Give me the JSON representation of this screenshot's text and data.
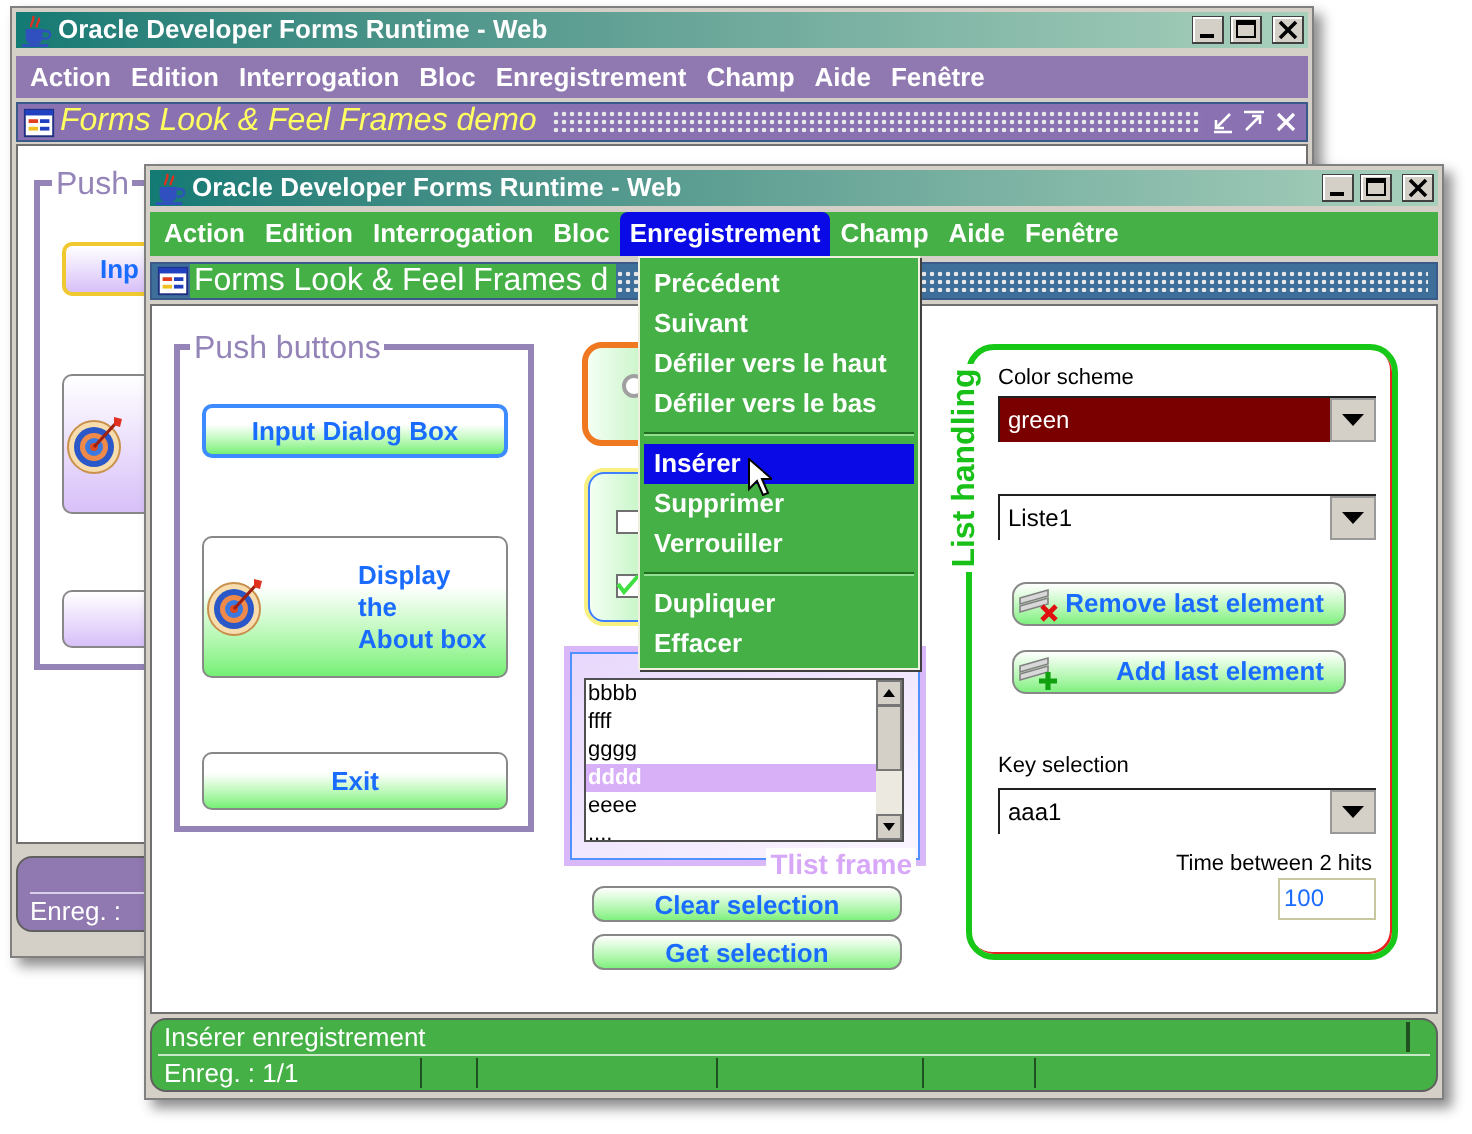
{
  "back_window": {
    "title": "Oracle Developer Forms Runtime - Web",
    "menu": [
      {
        "label": "Action"
      },
      {
        "label": "Edition"
      },
      {
        "label": "Interrogation"
      },
      {
        "label": "Bloc"
      },
      {
        "label": "Enregistrement"
      },
      {
        "label": "Champ"
      },
      {
        "label": "Aide"
      },
      {
        "label": "Fenêtre"
      }
    ],
    "form_title": "Forms Look & Feel Frames demo",
    "push_frame_label": "Push",
    "buttons": [
      {
        "kind": "text",
        "label": "Inp",
        "focused": true
      },
      {
        "kind": "icon",
        "focused": false
      },
      {
        "kind": "plain",
        "focused": false
      }
    ],
    "status_record": "Enreg. :"
  },
  "front_window": {
    "title": "Oracle Developer Forms Runtime - Web",
    "menu": [
      {
        "label": "Action",
        "selected": false
      },
      {
        "label": "Edition",
        "selected": false
      },
      {
        "label": "Interrogation",
        "selected": false
      },
      {
        "label": "Bloc",
        "selected": false
      },
      {
        "label": "Enregistrement",
        "selected": true
      },
      {
        "label": "Champ",
        "selected": false
      },
      {
        "label": "Aide",
        "selected": false
      },
      {
        "label": "Fenêtre",
        "selected": false
      }
    ],
    "form_title": "Forms Look & Feel Frames d",
    "dropdown_menu": [
      {
        "kind": "item",
        "label": "Précédent",
        "selected": false
      },
      {
        "kind": "item",
        "label": "Suivant",
        "selected": false
      },
      {
        "kind": "item",
        "label": "Défiler vers le haut",
        "selected": false
      },
      {
        "kind": "item",
        "label": "Défiler vers le bas",
        "selected": false
      },
      {
        "kind": "separator"
      },
      {
        "kind": "item",
        "label": "Insérer",
        "selected": true
      },
      {
        "kind": "item",
        "label": "Supprimer",
        "selected": false
      },
      {
        "kind": "item",
        "label": "Verrouiller",
        "selected": false
      },
      {
        "kind": "separator"
      },
      {
        "kind": "item",
        "label": "Dupliquer",
        "selected": false
      },
      {
        "kind": "item",
        "label": "Effacer",
        "selected": false
      }
    ],
    "push_buttons": {
      "label": "Push buttons",
      "buttons": [
        {
          "kind": "text",
          "label": "Input Dialog Box",
          "focused": true
        },
        {
          "kind": "icon",
          "lines": [
            "Display",
            "the",
            "About box"
          ],
          "focused": false
        },
        {
          "kind": "text",
          "label": "Exit",
          "focused": false
        }
      ]
    },
    "radio": {
      "selected": false
    },
    "checkboxes": [
      {
        "checked": false
      },
      {
        "checked": true
      }
    ],
    "tlist": {
      "label": "Tlist frame",
      "items": [
        {
          "label": "bbbb",
          "selected": false
        },
        {
          "label": "ffff",
          "selected": false
        },
        {
          "label": "gggg",
          "selected": false
        },
        {
          "label": "dddd",
          "selected": true
        },
        {
          "label": "eeee",
          "selected": false
        },
        {
          "label": "....",
          "selected": false
        }
      ]
    },
    "selection_buttons": [
      {
        "label": "Clear selection"
      },
      {
        "label": "Get selection"
      }
    ],
    "list_handling": {
      "label": "List handling",
      "color_scheme": {
        "label": "Color scheme",
        "value": "green",
        "focused": true
      },
      "list_select": {
        "value": "Liste1",
        "focused": false
      },
      "buttons": [
        {
          "kind": "remove",
          "label": "Remove last element"
        },
        {
          "kind": "add",
          "label": "Add last element"
        }
      ],
      "key_selection": {
        "label": "Key selection",
        "value": "aaa1",
        "focused": false
      },
      "time": {
        "label": "Time between 2 hits",
        "value": "100"
      }
    },
    "status_bar": {
      "message": "Insérer enregistrement",
      "record": "Enreg. : 1/1"
    }
  }
}
